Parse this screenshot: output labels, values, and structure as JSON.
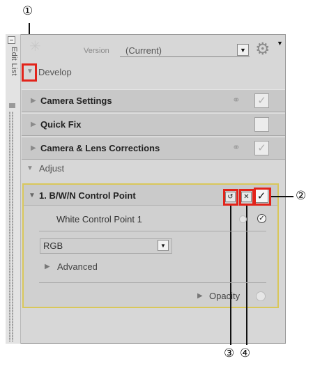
{
  "panel": {
    "side_label": "Edit List",
    "version_label": "Version",
    "version_value": "(Current)",
    "develop_label": "Develop",
    "sections": [
      {
        "label": "Camera Settings",
        "has_link": true,
        "checked": true
      },
      {
        "label": "Quick Fix",
        "has_link": false,
        "checked": false
      },
      {
        "label": "Camera & Lens Corrections",
        "has_link": true,
        "checked": true
      }
    ],
    "adjust_label": "Adjust",
    "control_point": {
      "title": "1. B/W/N Control Point",
      "white_point_label": "White Control Point 1",
      "channel_value": "RGB",
      "advanced_label": "Advanced",
      "opacity_label": "Opacity"
    }
  },
  "callouts": {
    "c1": "①",
    "c2": "②",
    "c3": "③",
    "c4": "④"
  },
  "glyphs": {
    "triangle_down": "▼",
    "triangle_right": "▶",
    "check": "✓",
    "close": "✕",
    "reset": "↺",
    "link": "⚭",
    "gear": "⚙"
  },
  "colors": {
    "callout_red": "#e2231a",
    "panel_highlight": "#d9c75a",
    "panel_bg": "#d7d7d7"
  }
}
